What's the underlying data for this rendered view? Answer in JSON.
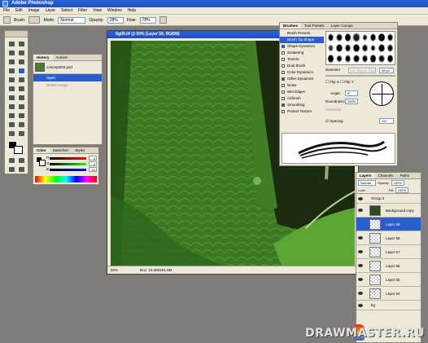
{
  "window": {
    "title": "Adobe Photoshop"
  },
  "menu": [
    "File",
    "Edit",
    "Image",
    "Layer",
    "Select",
    "Filter",
    "View",
    "Window",
    "Help"
  ],
  "options": {
    "brush_label": "Brush:",
    "mode_label": "Mode:",
    "mode_value": "Normal",
    "opacity_label": "Opacity:",
    "opacity_value": "28%",
    "flow_label": "Flow:",
    "flow_value": "78%"
  },
  "palette_tabs_top": [
    "Brushes",
    "Tool Presets",
    "Layer Comps"
  ],
  "history": {
    "tabs": [
      "History",
      "Actions"
    ],
    "snapshot": "concept002.psd",
    "items": [
      "Open",
      "Delete Image"
    ]
  },
  "document": {
    "title": "fig09.tif @ 50% (Layer 59, RGB/8)",
    "zoom": "50%",
    "doc_size": "Doc: 15.2M/201.0M"
  },
  "brushes": {
    "tabs": [
      "Brushes",
      "Tool Presets",
      "Layer Comps"
    ],
    "list": [
      "Brush Presets",
      "Brush Tip Shape",
      "Shape Dynamics",
      "Scattering",
      "Texture",
      "Dual Brush",
      "Color Dynamics",
      "Other Dynamics",
      "Noise",
      "Wet Edges",
      "Airbrush",
      "Smoothing",
      "Protect Texture"
    ],
    "selected": "Brush Tip Shape",
    "checked": [
      "Shape Dynamics",
      "Other Dynamics",
      "Smoothing"
    ],
    "diameter_label": "Diameter",
    "diameter_value": "38 px",
    "use_sample_size": "Use Sample Size",
    "flip_x": "Flip X",
    "flip_y": "Flip Y",
    "angle_label": "Angle:",
    "angle_value": "0°",
    "roundness_label": "Roundness:",
    "roundness_value": "100%",
    "hardness_label": "Hardness",
    "spacing_label": "Spacing",
    "spacing_value": "1%"
  },
  "color": {
    "tabs": [
      "Color",
      "Swatches",
      "Styles"
    ],
    "channels": [
      {
        "label": "R",
        "value": "0"
      },
      {
        "label": "G",
        "value": "0"
      },
      {
        "label": "B",
        "value": "10"
      }
    ]
  },
  "layers": {
    "tabs": [
      "Layers",
      "Channels",
      "Paths"
    ],
    "blend": "Normal",
    "opacity_label": "Opacity:",
    "opacity_value": "100%",
    "lock_label": "Lock:",
    "fill_label": "Fill:",
    "fill_value": "100%",
    "rows": [
      {
        "name": "Group 2",
        "type": "group"
      },
      {
        "name": "Background copy",
        "type": "image"
      },
      {
        "name": "Layer 59",
        "type": "layer",
        "selected": true
      },
      {
        "name": "Layer 58",
        "type": "layer"
      },
      {
        "name": "Layer 57",
        "type": "layer"
      },
      {
        "name": "Layer 56",
        "type": "layer"
      },
      {
        "name": "Layer 55",
        "type": "layer"
      },
      {
        "name": "Layer 54",
        "type": "layer"
      },
      {
        "name": "bg",
        "type": "group"
      }
    ]
  },
  "watermark": "DRAWMASTER.RU"
}
